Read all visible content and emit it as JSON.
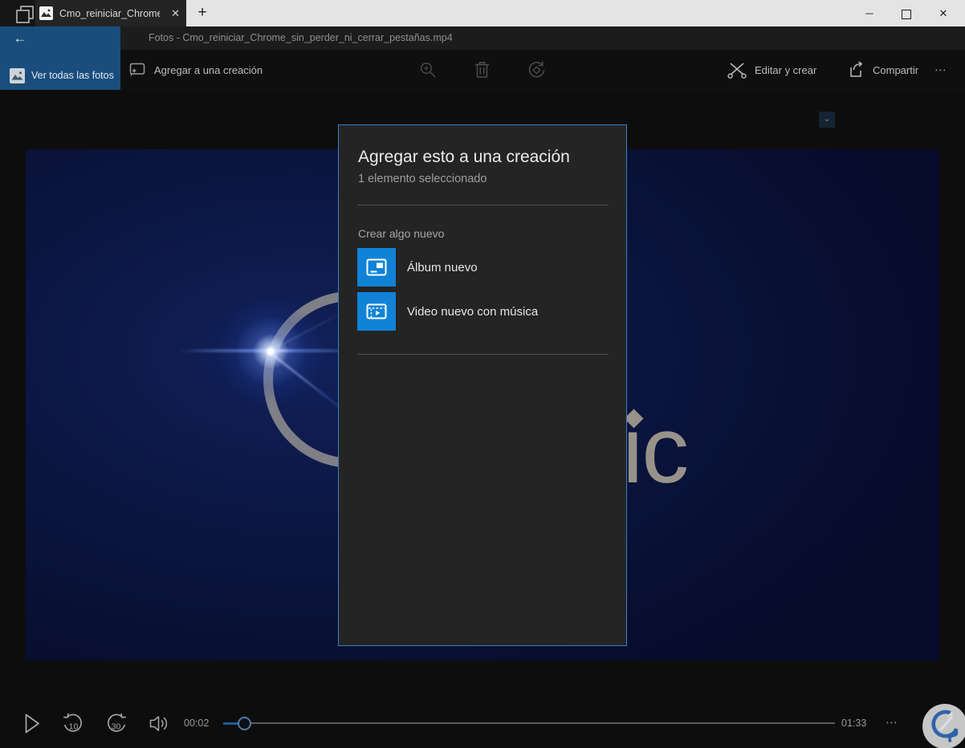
{
  "window": {
    "tab_title": "Cmo_reiniciar_Chrome_",
    "glyphs": {
      "plus": "+",
      "close": "✕",
      "minimize": "─",
      "back": "←",
      "chevron": "⌄",
      "ellipsis": "⋯"
    }
  },
  "titlebar": {
    "app_title": "Fotos - Cmo_reiniciar_Chrome_sin_perder_ni_cerrar_pestañas.mp4"
  },
  "toolbar": {
    "view_all_label": "Ver todas las fotos",
    "add_creation_label": "Agregar a una creación",
    "edit_create_label": "Editar y crear",
    "share_label": "Compartir"
  },
  "dialog": {
    "title": "Agregar esto a una creación",
    "subtitle": "1 elemento seleccionado",
    "section_label": "Crear algo nuevo",
    "items": [
      {
        "label": "Álbum nuevo",
        "icon": "album-icon"
      },
      {
        "label": "Video nuevo con música",
        "icon": "video-music-icon"
      }
    ],
    "accent_color": "#1183d6",
    "border_color": "#3f7cbd"
  },
  "video": {
    "logo_text": "ic"
  },
  "player": {
    "current_time": "00:02",
    "total_time": "01:33",
    "skip_back": "10",
    "skip_forward": "30"
  },
  "colors": {
    "accent_blue_panel": "#1a4d7c",
    "tile_blue": "#1183d6",
    "video_navy": "#0b1540"
  }
}
